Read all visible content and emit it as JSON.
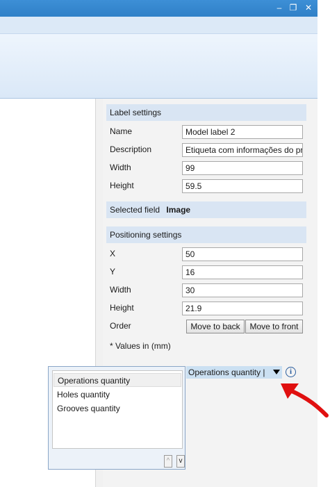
{
  "window": {
    "controls": [
      "–",
      "❐",
      "✕"
    ],
    "accent_color": "#2f80c7"
  },
  "label_settings": {
    "header": "Label settings",
    "name_label": "Name",
    "name_value": "Model label 2",
    "description_label": "Description",
    "description_value": "Etiqueta com informações do pr",
    "width_label": "Width",
    "width_value": "99",
    "height_label": "Height",
    "height_value": "59.5"
  },
  "selected_field": {
    "label": "Selected field",
    "value": "Image"
  },
  "positioning": {
    "header": "Positioning settings",
    "x_label": "X",
    "x_value": "50",
    "y_label": "Y",
    "y_value": "16",
    "width_label": "Width",
    "width_value": "30",
    "height_label": "Height",
    "height_value": "21.9",
    "order_label": "Order",
    "move_back": "Move to back",
    "move_front": "Move to front",
    "units_note": "* Values in (mm)"
  },
  "combo": {
    "value": "Operations quantity | H",
    "info_icon": "i"
  },
  "dropdown": {
    "items": [
      "Operations quantity",
      "Holes quantity",
      "Grooves quantity"
    ],
    "scroll_up": "^",
    "scroll_down": "v"
  },
  "annotation": {
    "color": "#e01010"
  }
}
